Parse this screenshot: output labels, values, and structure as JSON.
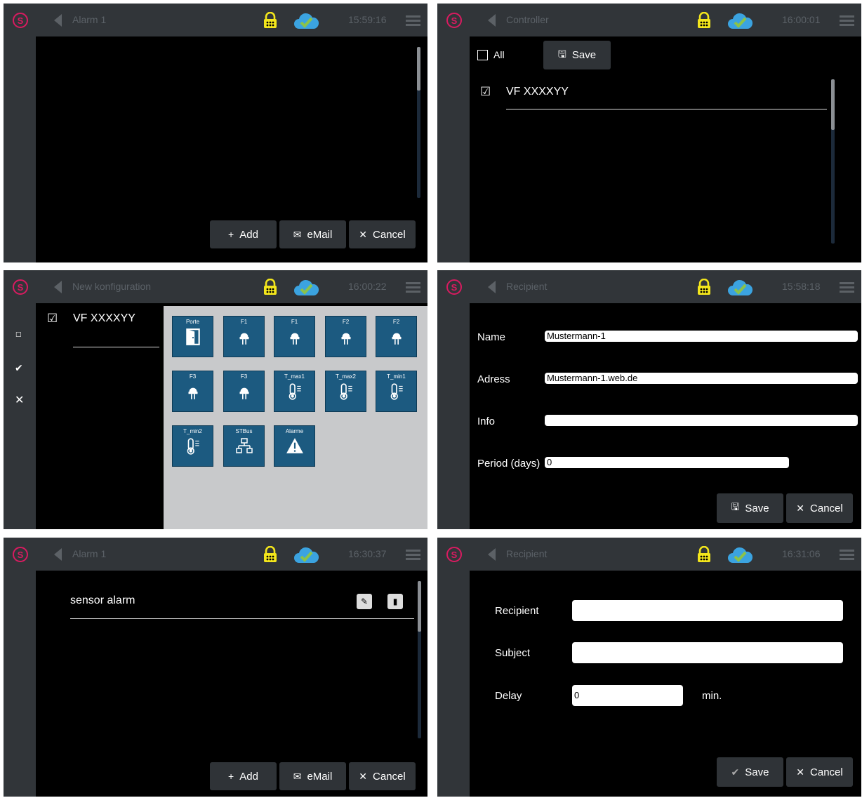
{
  "icons": {
    "logo": "s-logo-icon",
    "back": "back-arrow-icon",
    "lock": "lock-icon",
    "cloud": "cloud-check-icon",
    "menu": "hamburger-menu-icon"
  },
  "colors": {
    "topbar": "#313539",
    "button": "#2f3337",
    "tile": "#1c5a80",
    "tile_area": "#c8c9cb",
    "accent": "#d81b60"
  },
  "panel1": {
    "title": "Alarm 1",
    "time": "15:59:16",
    "buttons": {
      "add": "Add",
      "email": "eMail",
      "cancel": "Cancel"
    }
  },
  "panel2": {
    "title": "Controller",
    "time": "16:00:01",
    "all_label": "All",
    "save_label": "Save",
    "item": "VF XXXXYY"
  },
  "panel3": {
    "title": "New konfiguration",
    "time": "16:00:22",
    "item": "VF XXXXYY",
    "tiles": [
      {
        "label": "Porte",
        "icon": "door-icon"
      },
      {
        "label": "F1",
        "icon": "sensor-icon"
      },
      {
        "label": "F1",
        "icon": "sensor-icon"
      },
      {
        "label": "F2",
        "icon": "sensor-icon"
      },
      {
        "label": "F2",
        "icon": "sensor-icon"
      },
      {
        "label": "F3",
        "icon": "sensor-icon"
      },
      {
        "label": "F3",
        "icon": "sensor-icon"
      },
      {
        "label": "T_max1",
        "icon": "thermometer-icon"
      },
      {
        "label": "T_max2",
        "icon": "thermometer-icon"
      },
      {
        "label": "T_min1",
        "icon": "thermometer-icon"
      },
      {
        "label": "T_min2",
        "icon": "thermometer-icon"
      },
      {
        "label": "STBus",
        "icon": "network-icon"
      },
      {
        "label": "Alarme",
        "icon": "warning-icon"
      }
    ]
  },
  "panel4": {
    "title": "Recipient",
    "time": "15:58:18",
    "fields": {
      "name_label": "Name",
      "name_value": "Mustermann-1",
      "adress_label": "Adress",
      "adress_value": "Mustermann-1.web.de",
      "info_label": "Info",
      "info_value": "",
      "period_label": "Period (days)",
      "period_value": "0"
    },
    "save_label": "Save",
    "cancel_label": "Cancel"
  },
  "panel5": {
    "title": "Alarm 1",
    "time": "16:30:37",
    "item": "sensor alarm",
    "buttons": {
      "add": "Add",
      "email": "eMail",
      "cancel": "Cancel"
    }
  },
  "panel6": {
    "title": "Recipient",
    "time": "16:31:06",
    "fields": {
      "recipient_label": "Recipient",
      "recipient_value": "",
      "subject_label": "Subject",
      "subject_value": "",
      "delay_label": "Delay",
      "delay_value": "0",
      "delay_unit": "min."
    },
    "save_label": "Save",
    "cancel_label": "Cancel"
  }
}
